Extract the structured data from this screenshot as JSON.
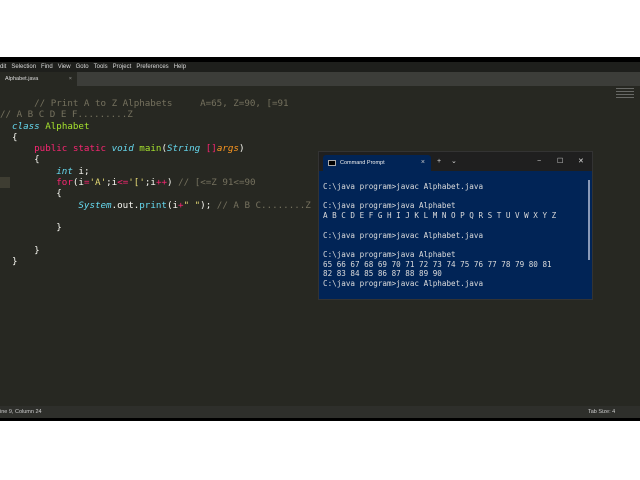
{
  "menu": [
    "dit",
    "Selection",
    "Find",
    "View",
    "Goto",
    "Tools",
    "Project",
    "Preferences",
    "Help"
  ],
  "tab": {
    "label": "Alphabet.java",
    "close": "×"
  },
  "code": [
    "    // Print A to Z Alphabets     A=65, Z=90, [=91",
    "// A B C D E F.........Z",
    "class Alphabet",
    "{",
    "    public static void main(String []args)",
    "    {",
    "        int i;",
    "        for(i='A';i<='[';i++) // [<=Z 91<=90",
    "        {",
    "            System.out.print(i+\" \"); // A B C........Z",
    "",
    "        }",
    "",
    "    }",
    "}"
  ],
  "status": {
    "position": "ine 9, Column 24",
    "tab_size": "Tab Size: 4"
  },
  "terminal": {
    "tab_label": "Command Prompt",
    "close": "×",
    "new_tab": "+",
    "dropdown": "⌄",
    "minimize": "−",
    "maximize": "☐",
    "close_window": "✕",
    "lines": [
      "",
      "C:\\java program>javac Alphabet.java",
      "",
      "C:\\java program>java Alphabet",
      "A B C D E F G H I J K L M N O P Q R S T U V W X Y Z",
      "",
      "C:\\java program>javac Alphabet.java",
      "",
      "C:\\java program>java Alphabet",
      "65 66 67 68 69 70 71 72 73 74 75 76 77 78 79 80 81",
      "82 83 84 85 86 87 88 89 90",
      "C:\\java program>javac Alphabet.java"
    ]
  }
}
